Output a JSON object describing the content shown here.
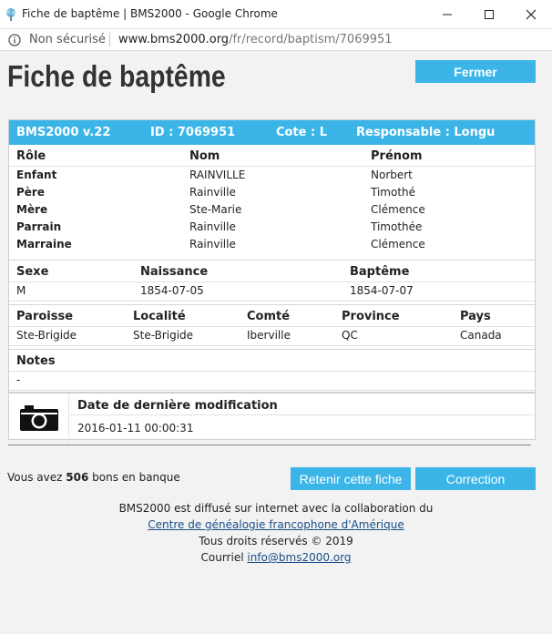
{
  "window": {
    "title": "Fiche de baptême | BMS2000 - Google Chrome",
    "address_security": "Non sécurisé",
    "url_host": "www.bms2000.org",
    "url_path": "/fr/record/baptism/7069951"
  },
  "page": {
    "title": "Fiche de baptême",
    "close_label": "Fermer"
  },
  "record_header": {
    "version": "BMS2000 v.22",
    "id": "ID : 7069951",
    "cote": "Cote : L",
    "responsable": "Responsable : Longu"
  },
  "people": {
    "headers": [
      "Rôle",
      "Nom",
      "Prénom"
    ],
    "rows": [
      {
        "role": "Enfant",
        "nom": "RAINVILLE",
        "prenom": "Norbert"
      },
      {
        "role": "Père",
        "nom": "Rainville",
        "prenom": "Timothé"
      },
      {
        "role": "Mère",
        "nom": "Ste-Marie",
        "prenom": "Clémence"
      },
      {
        "role": "Parrain",
        "nom": "Rainville",
        "prenom": "Timothée"
      },
      {
        "role": "Marraine",
        "nom": "Rainville",
        "prenom": "Clémence"
      }
    ]
  },
  "vitals": {
    "headers": [
      "Sexe",
      "Naissance",
      "Baptême"
    ],
    "values": [
      "M",
      "1854-07-05",
      "1854-07-07"
    ]
  },
  "place": {
    "headers": [
      "Paroisse",
      "Localité",
      "Comté",
      "Province",
      "Pays"
    ],
    "values": [
      "Ste-Brigide",
      "Ste-Brigide",
      "Iberville",
      "QC",
      "Canada"
    ]
  },
  "notes": {
    "header": "Notes",
    "value": "-"
  },
  "modification": {
    "header": "Date de dernière modification",
    "value": "2016-01-11 00:00:31"
  },
  "bank": {
    "prefix": "Vous avez",
    "count": "506",
    "suffix": "bons en banque"
  },
  "actions": {
    "keep_label": "Retenir cette fiche",
    "correction_label": "Correction"
  },
  "footer": {
    "line1": "BMS2000 est diffusé sur internet avec la collaboration du",
    "link1": "Centre de généalogie francophone d'Amérique",
    "line3": "Tous droits réservés © 2019",
    "email_prefix": "Courriel",
    "email": "info@bms2000.org"
  },
  "colors": {
    "accent": "#3bb5e8",
    "link": "#1a4f8a"
  },
  "icons": [
    "app-tree-icon",
    "minimize-icon",
    "maximize-icon",
    "close-icon",
    "info-icon",
    "camera-icon"
  ]
}
